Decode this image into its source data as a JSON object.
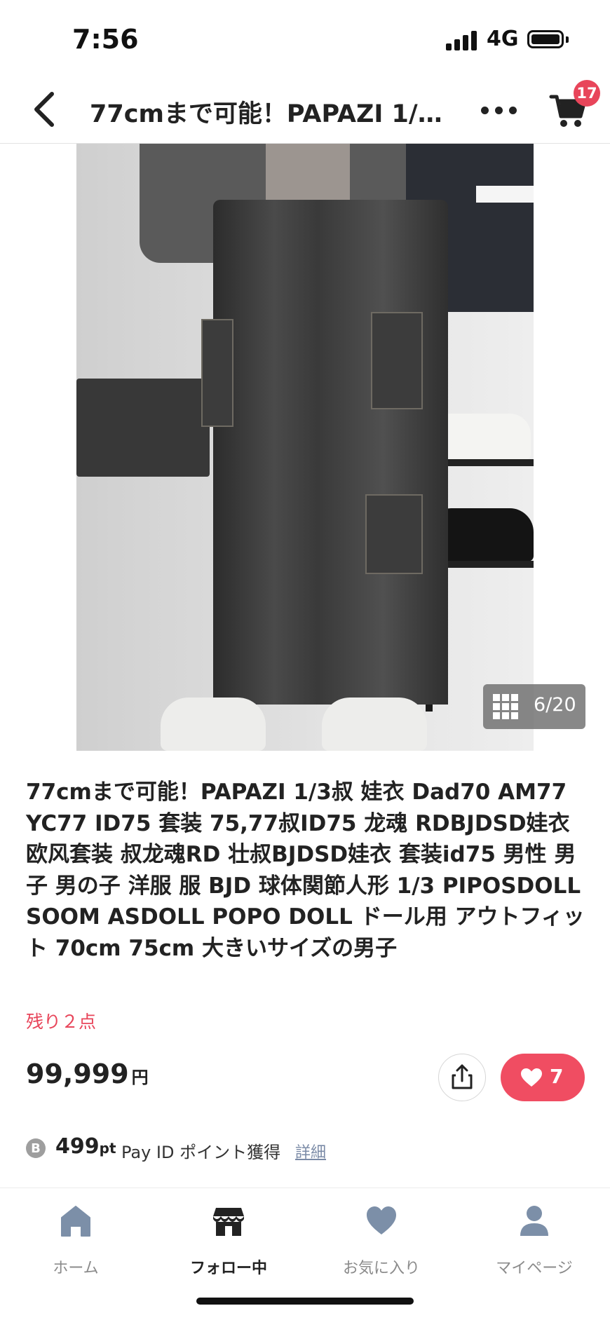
{
  "status_bar": {
    "time": "7:56",
    "network": "4G"
  },
  "header": {
    "title": "77cmまで可能！PAPAZI 1/3叔 娃衣 Dad70 AM77 YC77 ID75 套装",
    "cart_count": "17",
    "icons": [
      "back-arrow-icon",
      "more-dots-icon",
      "cart-icon"
    ]
  },
  "gallery": {
    "counter": "6/20",
    "icon": "grid-icon"
  },
  "product": {
    "title": "77cmまで可能！PAPAZI 1/3叔 娃衣 Dad70 AM77 YC77 ID75 套装 75,77叔ID75 龙魂 RDBJDSD娃衣欧风套装 叔龙魂RD 壮叔BJDSD娃衣 套装id75 男性 男子 男の子 洋服 服  BJD  球体関節人形 1/3 PIPOSDOLL SOOM ASDOLL POPO  DOLL ドール用 アウトフィット  70cm 75cm 大きいサイズの男子",
    "stock": "残り２点",
    "price": "99,999",
    "price_unit": "円",
    "likes": "7"
  },
  "points": {
    "icon_letter": "B",
    "value": "499",
    "unit": "pt",
    "label": "Pay ID ポイント獲得",
    "detail_link": "詳細"
  },
  "tab_bar": {
    "items": [
      {
        "label": "ホーム",
        "icon": "home-icon"
      },
      {
        "label": "フォロー中",
        "icon": "store-icon",
        "active": true
      },
      {
        "label": "お気に入り",
        "icon": "heart-icon"
      },
      {
        "label": "マイページ",
        "icon": "person-icon"
      }
    ]
  },
  "colors": {
    "accent": "#f04d62",
    "badge": "#e8455a",
    "stock_text": "#e8455a",
    "link": "#7a8aa6"
  }
}
